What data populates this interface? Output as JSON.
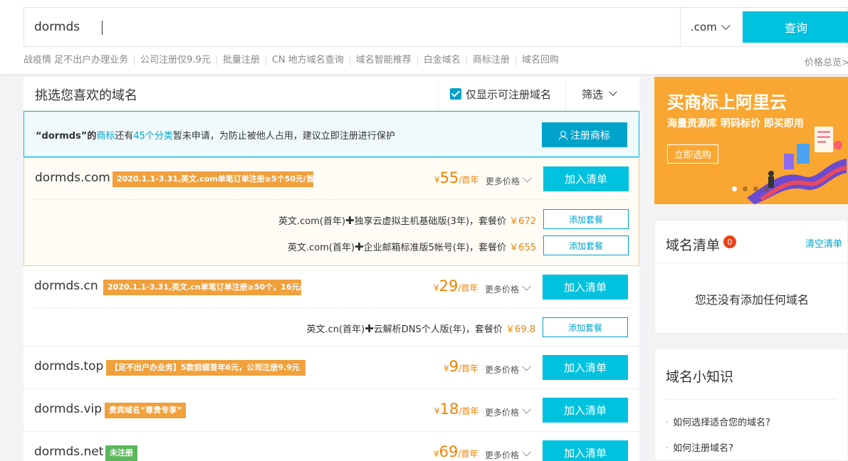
{
  "search": {
    "value": "dormds",
    "suffix": ".com",
    "button": "查询"
  },
  "quick_links": [
    "战疫情 足不出户办理业务",
    "公司注册仅9.9元",
    "批量注册",
    "CN 地方域名查询",
    "域名智能推荐",
    "白金域名",
    "商标注册",
    "域名回购"
  ],
  "price_overview": "价格总览>",
  "main": {
    "title": "挑选您喜欢的域名",
    "only_registrable": "仅显示可注册域名",
    "filter": "筛选"
  },
  "notice": {
    "quote_open": "“",
    "keyword": "dormds",
    "text1": "”的",
    "link1": "商标",
    "text2": "还有",
    "link2": "45个分类",
    "text3": "暂未申请，为防止被他人占用，建议立即注册进行保护",
    "button": "注册商标"
  },
  "currency": "¥",
  "unit": "/首年",
  "more_price": "更多价格",
  "add_label": "加入清单",
  "add_package": "添加套餐",
  "rows": [
    {
      "domain": "dormds.com",
      "tag": "2020.1.1-3.31,英文.com单笔订单注册≥5个50元/首年",
      "price": "55",
      "packages": [
        {
          "left": "英文.com(首年)",
          "right": "独享云虚拟主机基础版(3年)，套餐价",
          "price": "￥672"
        },
        {
          "left": "英文.com(首年)",
          "right": "企业邮箱标准版5帐号(年)，套餐价",
          "price": "￥655"
        }
      ]
    },
    {
      "domain": "dormds.cn",
      "tag": "2020.1.1-3.31,英文.cn单笔订单注册≥50个，16元/首年",
      "price": "29",
      "packages": [
        {
          "left": "英文.cn(首年)",
          "right": "云解析DNS个人版(年)，套餐价",
          "price": "￥69.8"
        }
      ]
    },
    {
      "domain": "dormds.top",
      "tag": "【足不出户办业务】5款前缀首年6元，公司注册9.9元",
      "price": "9"
    },
    {
      "domain": "dormds.vip",
      "tag": "贵宾域名“尊贵专享”",
      "price": "18"
    },
    {
      "domain": "dormds.net",
      "tag": "未注册",
      "price": "69"
    }
  ],
  "ad": {
    "title": "买商标上阿里云",
    "subtitle": "海量资源库 明码标价 即买即用",
    "button": "立即选购"
  },
  "cart": {
    "title": "域名清单",
    "count": "0",
    "clear": "清空清单",
    "empty": "您还没有添加任何域名"
  },
  "tips": {
    "title": "域名小知识",
    "items": [
      "如何选择适合您的域名?",
      "如何注册域名?"
    ]
  },
  "colors": {
    "accent": "#00c1de",
    "link": "#00a2ca",
    "price": "#f08300",
    "tag": "#f0a03c",
    "tag_green": "#5cb85c",
    "badge": "#e8431b",
    "ad_bg": "#f9a732"
  }
}
